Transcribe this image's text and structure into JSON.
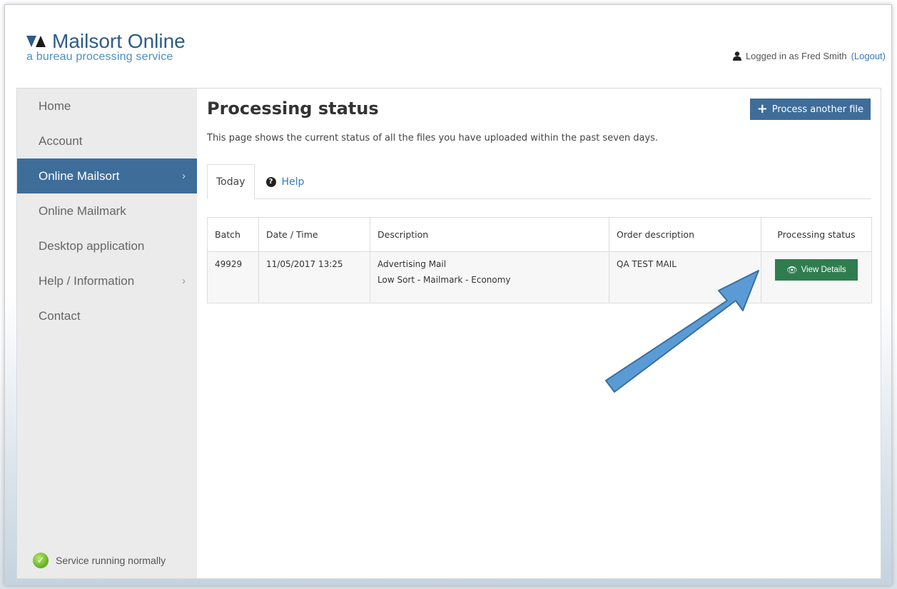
{
  "header": {
    "logo_title": "Mailsort Online",
    "logo_subtitle": "a bureau processing service",
    "user_text": "Logged in as Fred Smith",
    "logout_label": "(Logout)"
  },
  "sidebar": {
    "items": [
      {
        "label": "Home",
        "chevron": false,
        "active": false
      },
      {
        "label": "Account",
        "chevron": false,
        "active": false
      },
      {
        "label": "Online Mailsort",
        "chevron": true,
        "active": true
      },
      {
        "label": "Online Mailmark",
        "chevron": false,
        "active": false
      },
      {
        "label": "Desktop application",
        "chevron": false,
        "active": false
      },
      {
        "label": "Help / Information",
        "chevron": true,
        "active": false
      },
      {
        "label": "Contact",
        "chevron": false,
        "active": false
      }
    ],
    "status_text": "Service running normally"
  },
  "main": {
    "title": "Processing status",
    "process_button_label": "Process another file",
    "intro": "This page shows the current status of all the files you have uploaded within the past seven days.",
    "tabs": [
      {
        "label": "Today",
        "active": true
      },
      {
        "label": "Help",
        "active": false
      }
    ],
    "table": {
      "headers": [
        "Batch",
        "Date / Time",
        "Description",
        "Order description",
        "Processing status"
      ],
      "rows": [
        {
          "batch": "49929",
          "datetime": "11/05/2017 13:25",
          "description_line1": "Advertising Mail",
          "description_line2": "Low Sort - Mailmark - Economy",
          "order_description": "QA TEST MAIL",
          "action_label": "View Details"
        }
      ]
    }
  },
  "colors": {
    "brand_blue": "#3e6d9a",
    "view_green": "#2f7d4f",
    "annotation_arrow": "#5b9bd5",
    "status_ok": "#5fae1f"
  }
}
